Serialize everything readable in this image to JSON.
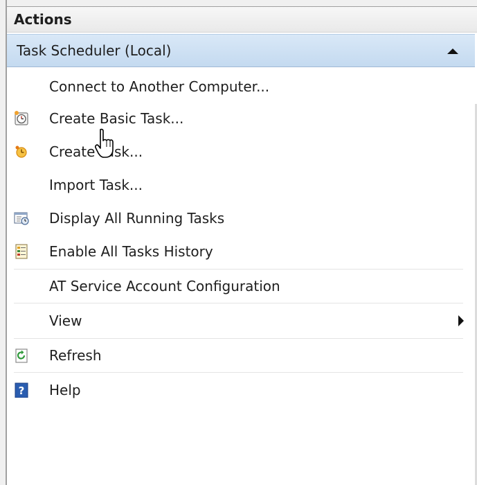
{
  "panel": {
    "title": "Actions"
  },
  "group": {
    "label": "Task Scheduler (Local)",
    "state": "expanded"
  },
  "actions": [
    {
      "label": "Connect to Another Computer...",
      "icon": "none"
    },
    {
      "label": "Create Basic Task...",
      "icon": "basic-task-clock-icon"
    },
    {
      "label": "Create Task...",
      "icon": "task-clock-icon"
    },
    {
      "label": "Import Task...",
      "icon": "none"
    },
    {
      "label": "Display All Running Tasks",
      "icon": "running-tasks-icon"
    },
    {
      "label": "Enable All Tasks History",
      "icon": "tasks-history-icon"
    },
    {
      "label": "AT Service Account Configuration",
      "icon": "none"
    },
    {
      "label": "View",
      "icon": "none",
      "submenu": true
    },
    {
      "label": "Refresh",
      "icon": "refresh-icon"
    },
    {
      "label": "Help",
      "icon": "help-icon"
    }
  ],
  "colors": {
    "group_header_top": "#d9e8f7",
    "group_header_bottom": "#c4daf0",
    "text": "#1e1e1e",
    "help_blue": "#2a5db0",
    "refresh_green": "#2f9a3b",
    "clock_orange": "#f0a22e"
  }
}
